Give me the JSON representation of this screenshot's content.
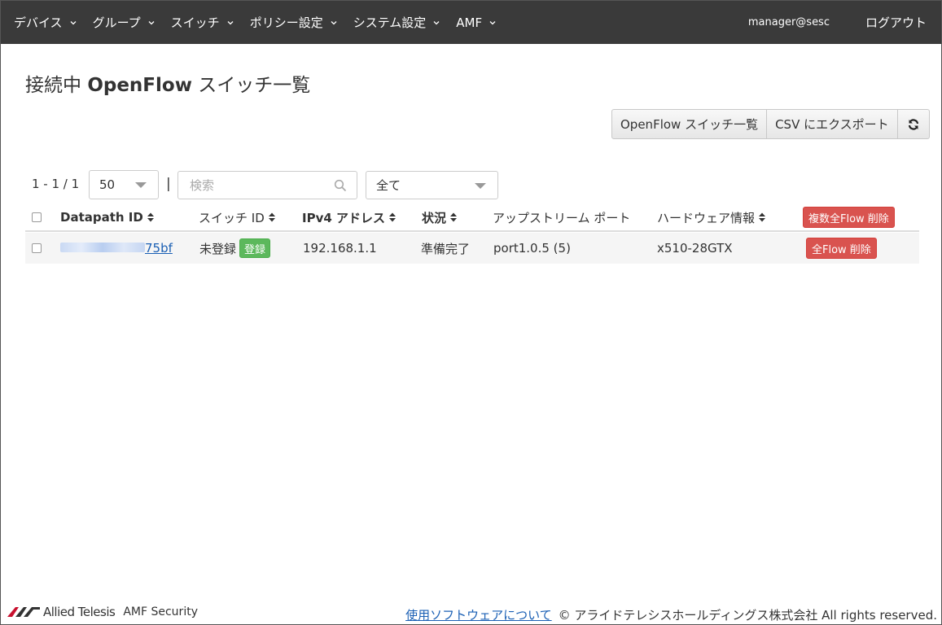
{
  "nav": {
    "items": [
      {
        "label": "デバイス"
      },
      {
        "label": "グループ"
      },
      {
        "label": "スイッチ"
      },
      {
        "label": "ポリシー設定"
      },
      {
        "label": "システム設定"
      },
      {
        "label": "AMF"
      }
    ],
    "user": "manager@sesc",
    "logout": "ログアウト"
  },
  "page": {
    "title_prefix": "接続中 ",
    "title_bold": "OpenFlow",
    "title_suffix": " スイッチ一覧"
  },
  "toolbar": {
    "switch_list": "OpenFlow スイッチ一覧",
    "csv_export": "CSV にエクスポート",
    "refresh_icon": "refresh-icon"
  },
  "filters": {
    "range": "1 - 1 / 1",
    "per_page": "50",
    "separator": "|",
    "search_placeholder": "検索",
    "status_filter": "全て"
  },
  "table": {
    "headers": {
      "datapath_id": "Datapath ID",
      "switch_id": "スイッチ ID",
      "ipv4": "IPv4 アドレス",
      "status": "状況",
      "upstream_port": "アップストリーム ポート",
      "hardware": "ハードウェア情報",
      "bulk_delete": "複数全Flow 削除"
    },
    "rows": [
      {
        "datapath_id_suffix": "75bf",
        "switch_id": "未登録",
        "register": "登録",
        "ipv4": "192.168.1.1",
        "status": "準備完了",
        "upstream_port": "port1.0.5 (5)",
        "hardware": "x510-28GTX",
        "delete": "全Flow 削除"
      }
    ]
  },
  "footer": {
    "brand": "Allied Telesis",
    "product": "AMF Security",
    "about_link": "使用ソフトウェアについて",
    "copyright": "© アライドテレシスホールディングス株式会社 All rights reserved."
  },
  "colors": {
    "navbar": "#3a3a3a",
    "danger": "#d9534f",
    "success": "#5cb85c",
    "link": "#1a5fb4"
  }
}
